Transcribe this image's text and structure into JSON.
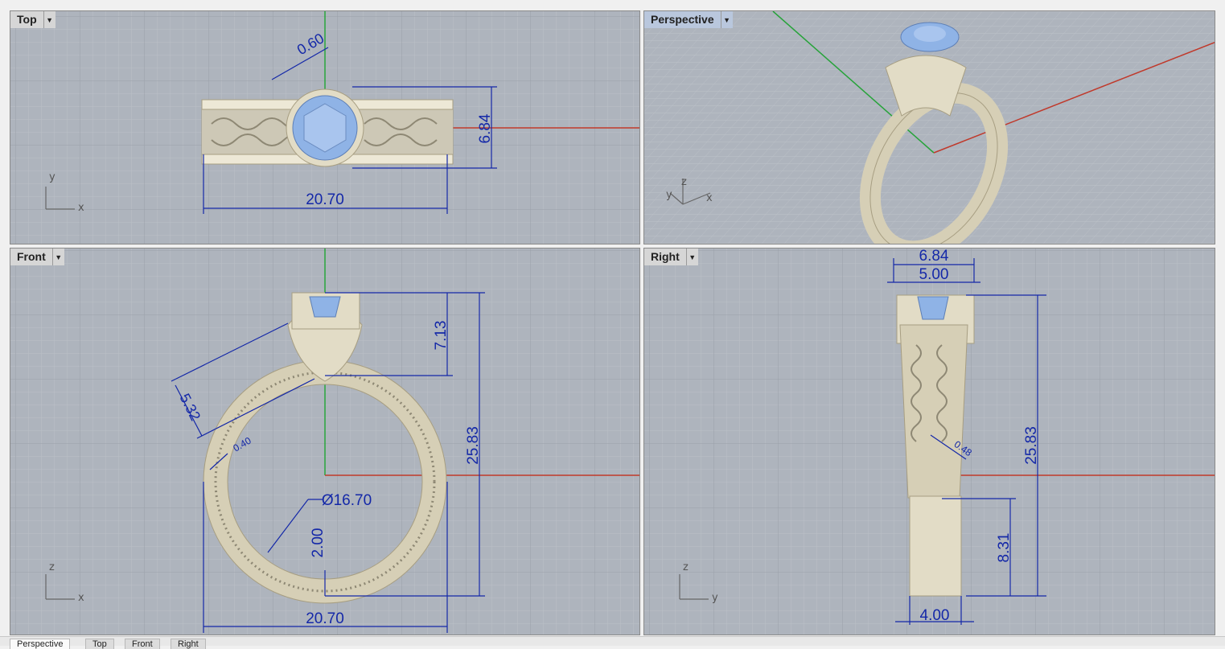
{
  "viewports": {
    "top": {
      "name": "Top",
      "axes": {
        "vertical": "y",
        "horizontal": "x"
      },
      "dims": {
        "prong": "0.60",
        "height": "6.84",
        "width": "20.70"
      }
    },
    "perspective": {
      "name": "Perspective",
      "axes": {
        "y": "y",
        "z": "z",
        "x": "x"
      }
    },
    "front": {
      "name": "Front",
      "axes": {
        "vertical": "z",
        "horizontal": "x"
      },
      "dims": {
        "head": "7.13",
        "total_height": "25.83",
        "shoulder": "5.32",
        "wire": "0.40",
        "inner_diameter": "Ø16.70",
        "shank": "2.00",
        "width": "20.70"
      }
    },
    "right": {
      "name": "Right",
      "axes": {
        "vertical": "z",
        "horizontal": "y"
      },
      "dims": {
        "top_outer": "6.84",
        "top_inner": "5.00",
        "wire": "0.48",
        "total_height": "25.83",
        "lower": "8.31",
        "bottom": "4.00"
      }
    }
  },
  "tabs": [
    {
      "label": "Perspective",
      "active": true
    },
    {
      "label": "Top",
      "active": false
    },
    {
      "label": "Front",
      "active": false
    },
    {
      "label": "Right",
      "active": false
    }
  ],
  "colors": {
    "viewport_bg": "#aeb4bd",
    "grid_minor": "#bcc1c8",
    "grid_major": "#9aa0a9",
    "x_axis": "#c0392b",
    "y_axis": "#27a33a",
    "dimension": "#1428a8",
    "metal": "#e2dcc6",
    "gem": "#8fb3e6"
  }
}
